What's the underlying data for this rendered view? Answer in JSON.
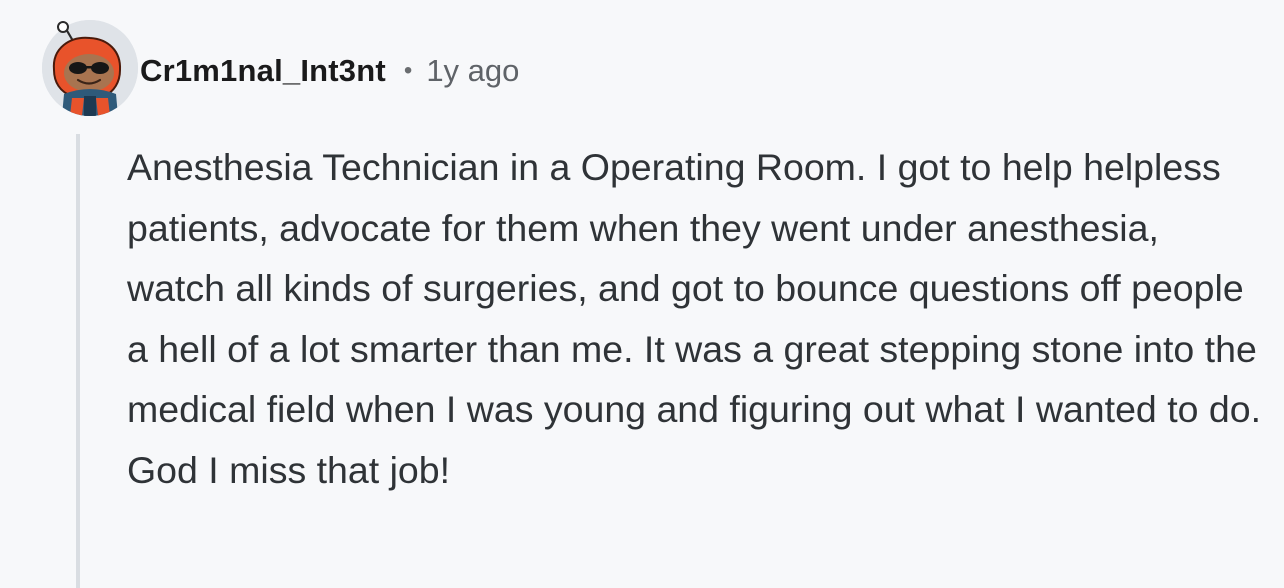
{
  "comment": {
    "author": "Cr1m1nal_Int3nt",
    "separator": "•",
    "timestamp": "1y ago",
    "body": "Anesthesia Technician in a Operating Room. I got to help helpless patients, advocate for them when they went under anesthesia, watch all kinds of surgeries, and got to bounce questions off people a hell of a lot smarter than me. It was a great stepping stone into the medical field when I was young and figuring out what I wanted to do. God I miss that job!"
  },
  "avatar": {
    "icon": "snoo-avatar-icon",
    "hood_color": "#e8532b",
    "background_color": "#dfe3e8"
  }
}
